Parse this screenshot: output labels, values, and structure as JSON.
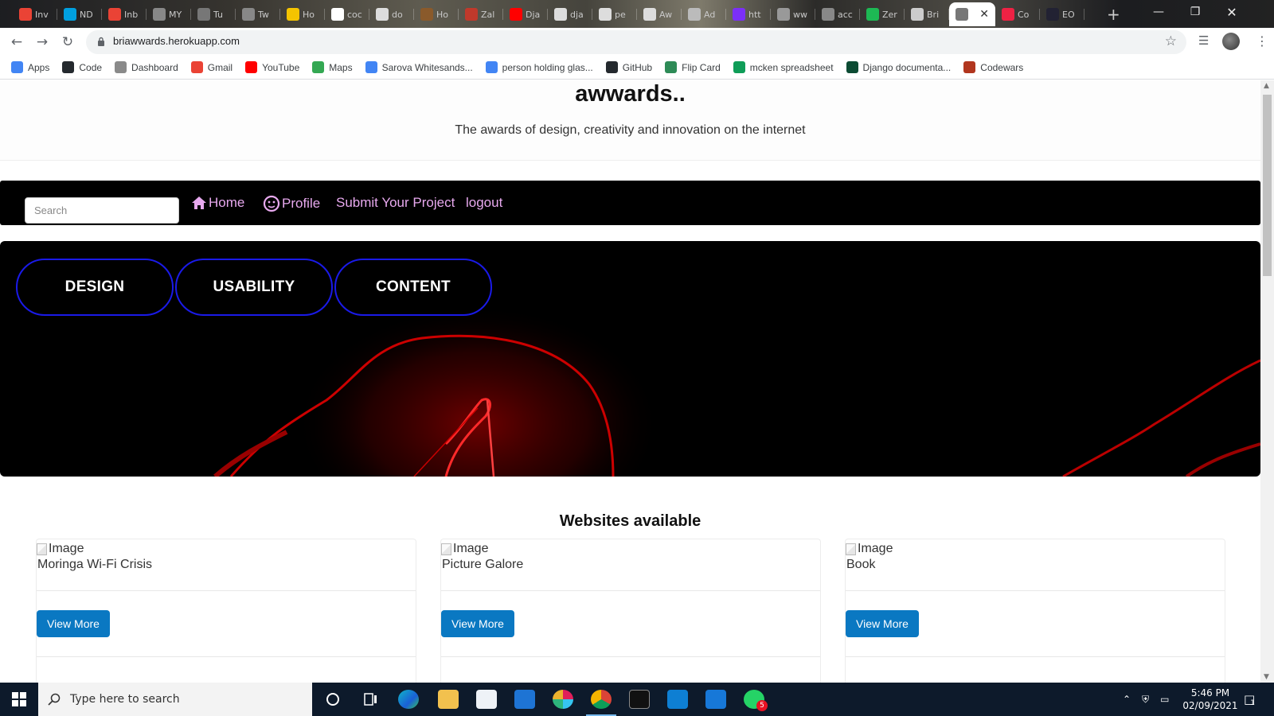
{
  "browser": {
    "tabs": [
      {
        "label": "Inv",
        "icon": "gmail-icon",
        "color": "#ea4335"
      },
      {
        "label": "ND",
        "icon": "y-icon",
        "color": "#00a0e0"
      },
      {
        "label": "Inb",
        "icon": "gmail-icon",
        "color": "#ea4335"
      },
      {
        "label": "MY",
        "icon": "github-icon",
        "color": "#888"
      },
      {
        "label": "Tu",
        "icon": "palm-icon",
        "color": "#777"
      },
      {
        "label": "Tw",
        "icon": "globe-icon",
        "color": "#888"
      },
      {
        "label": "Ho",
        "icon": "emoji-icon",
        "color": "#f5c400"
      },
      {
        "label": "coc",
        "icon": "google-icon",
        "color": "#fff"
      },
      {
        "label": "do",
        "icon": "docs-icon",
        "color": "#ddd"
      },
      {
        "label": "Ho",
        "icon": "circle-icon",
        "color": "#8a5a2b"
      },
      {
        "label": "Zal",
        "icon": "circle-icon",
        "color": "#c0392b"
      },
      {
        "label": "Dja",
        "icon": "youtube-icon",
        "color": "#ff0000"
      },
      {
        "label": "dja",
        "icon": "github-icon",
        "color": "#ddd"
      },
      {
        "label": "pe",
        "icon": "github-icon",
        "color": "#ddd"
      },
      {
        "label": "Aw",
        "icon": "github-icon",
        "color": "#ddd"
      },
      {
        "label": "Ad",
        "icon": "globe-icon",
        "color": "#bbb"
      },
      {
        "label": "htt",
        "icon": "b-icon",
        "color": "#7b2ff7"
      },
      {
        "label": "ww",
        "icon": "d-icon",
        "color": "#999"
      },
      {
        "label": "acc",
        "icon": "globe-icon",
        "color": "#888"
      },
      {
        "label": "Zer",
        "icon": "d-icon",
        "color": "#1db954"
      },
      {
        "label": "Bri",
        "icon": "github-icon",
        "color": "#ccc"
      },
      {
        "label": "",
        "icon": "globe-icon",
        "color": "#777",
        "active": true
      },
      {
        "label": "Co",
        "icon": "asterisk-icon",
        "color": "#e24"
      },
      {
        "label": "EO",
        "icon": "circle-icon",
        "color": "#223"
      }
    ],
    "url": "briawwards.herokuapp.com",
    "bookmarks": [
      {
        "label": "Apps",
        "icon": "apps-grid-icon"
      },
      {
        "label": "Code",
        "icon": "github-icon"
      },
      {
        "label": "Dashboard",
        "icon": "palm-icon"
      },
      {
        "label": "Gmail",
        "icon": "gmail-icon"
      },
      {
        "label": "YouTube",
        "icon": "youtube-icon"
      },
      {
        "label": "Maps",
        "icon": "maps-pin-icon"
      },
      {
        "label": "Sarova Whitesands...",
        "icon": "google-icon"
      },
      {
        "label": "person holding glas...",
        "icon": "google-icon"
      },
      {
        "label": "GitHub",
        "icon": "github-icon"
      },
      {
        "label": "Flip Card",
        "icon": "w-icon"
      },
      {
        "label": "mcken spreadsheet",
        "icon": "sheets-icon"
      },
      {
        "label": "Django documenta...",
        "icon": "django-icon"
      },
      {
        "label": "Codewars",
        "icon": "codewars-icon"
      }
    ]
  },
  "site": {
    "title": "awwards..",
    "tagline": "The awards of design, creativity and innovation on the internet",
    "nav": {
      "search_placeholder": "Search",
      "home": "Home",
      "profile": "Profile",
      "submit": "Submit Your Project",
      "logout": "logout"
    },
    "categories": [
      "DESIGN",
      "USABILITY",
      "CONTENT"
    ],
    "section_title": "Websites available",
    "projects": [
      {
        "image_alt": "Image",
        "title": "Moringa Wi-Fi Crisis",
        "button": "View More"
      },
      {
        "image_alt": "Image",
        "title": "Picture Galore",
        "button": "View More"
      },
      {
        "image_alt": "Image",
        "title": "Book",
        "button": "View More"
      }
    ]
  },
  "taskbar": {
    "search_placeholder": "Type here to search",
    "time": "5:46 PM",
    "date": "02/09/2021",
    "whatsapp_badge": "5",
    "notification_count": "1"
  },
  "colors": {
    "nav_link": "#e8a9ef",
    "pill_border": "#1a1ae8",
    "view_button": "#0a78c2"
  }
}
